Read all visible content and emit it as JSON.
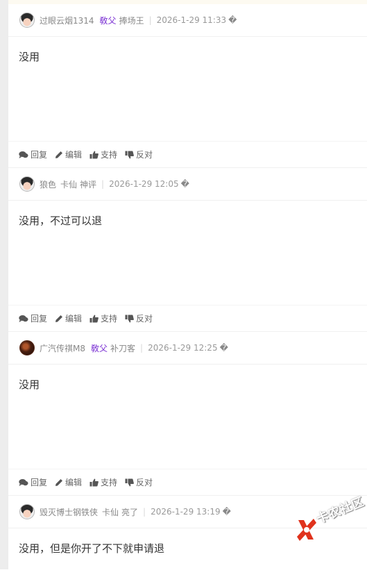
{
  "posts": [
    {
      "username": "过眼云烟1314",
      "badge": "敎父",
      "title": "捧场王",
      "time": "2026-1-29 11:33",
      "more": "�",
      "content": "没用",
      "actions": {
        "reply": "回复",
        "edit": "编辑",
        "support": "支持",
        "oppose": "反对"
      }
    },
    {
      "username": "狼色",
      "badge": "卡仙",
      "title": "神评",
      "time": "2026-1-29 12:05",
      "more": "�",
      "content": "没用，不过可以退",
      "actions": {
        "reply": "回复",
        "edit": "编辑",
        "support": "支持",
        "oppose": "反对"
      }
    },
    {
      "username": "广汽传祺M8",
      "badge": "敎父",
      "title": "补刀客",
      "time": "2026-1-29 12:25",
      "more": "�",
      "content": "没用",
      "actions": {
        "reply": "回复",
        "edit": "编辑",
        "support": "支持",
        "oppose": "反对"
      }
    },
    {
      "username": "毁灭博士钢铁侠",
      "badge": "卡仙",
      "title": "亮了",
      "time": "2026-1-29 13:19",
      "more": "�",
      "content": "没用，但是你开了不下就申请退"
    }
  ],
  "watermark": {
    "text": "卡农社区"
  },
  "colors": {
    "badge_purple": "#7a2fd3",
    "meta_gray": "#888888",
    "body_text": "#333333",
    "watermark_red": "#e0321c"
  }
}
